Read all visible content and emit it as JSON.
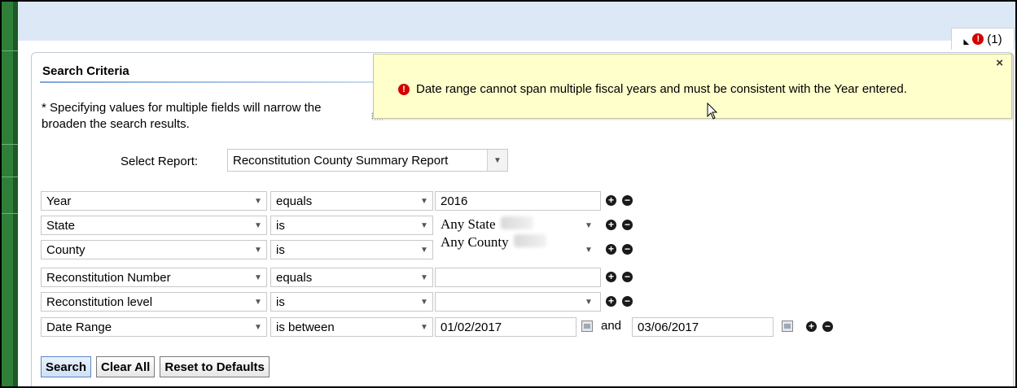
{
  "notification": {
    "count_label": "(1)"
  },
  "panel": {
    "title": "Search Criteria",
    "info_line1": "* Specifying values for multiple fields will narrow the",
    "info_line2": "broaden the search results."
  },
  "tooltip": {
    "close_label": "×",
    "message": "Date range cannot span multiple fiscal years and must be consistent with the Year entered."
  },
  "report": {
    "label": "Select Report:",
    "selected": "Reconstitution County Summary Report"
  },
  "criteria": [
    {
      "field": "Year",
      "operator": "equals",
      "value": "2016"
    },
    {
      "field": "State",
      "operator": "is",
      "value": "Any State"
    },
    {
      "field": "County",
      "operator": "is",
      "value": "Any County"
    },
    {
      "field": "Reconstitution Number",
      "operator": "equals",
      "value": ""
    },
    {
      "field": "Reconstitution level",
      "operator": "is",
      "value": ""
    },
    {
      "field": "Date Range",
      "operator": "is between",
      "value": "01/02/2017",
      "value2": "03/06/2017",
      "joiner": "and"
    }
  ],
  "buttons": {
    "search": "Search",
    "clear_all": "Clear All",
    "reset": "Reset to Defaults"
  },
  "icons": {
    "dropdown": "chevron-down-icon",
    "add": "plus-circle-icon",
    "remove": "minus-circle-icon",
    "calendar": "calendar-icon",
    "error": "error-circle-icon"
  },
  "colors": {
    "error": "#d50000",
    "tooltip_bg": "#ffffcc",
    "header_bg": "#dde8f6",
    "sidebar_green": "#2f7f39"
  }
}
